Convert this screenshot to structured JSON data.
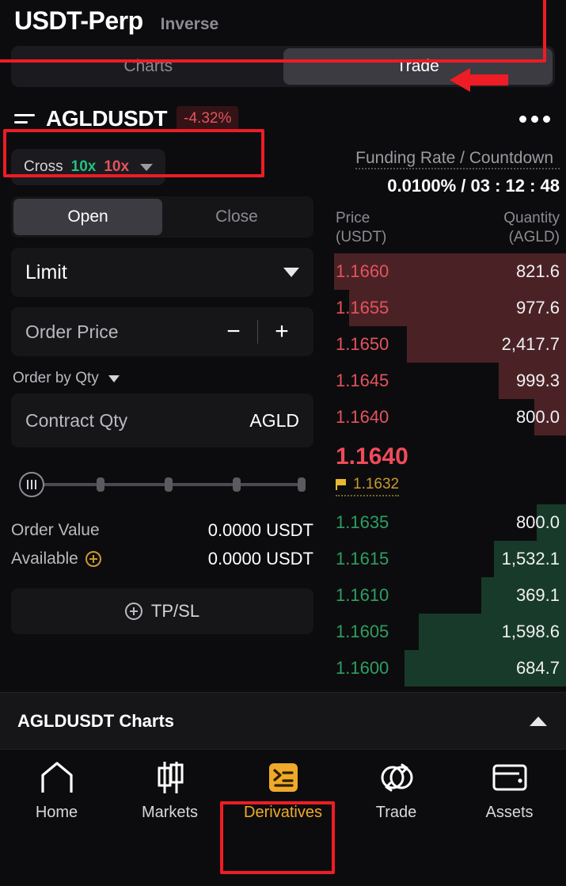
{
  "header": {
    "title": "USDT-Perp",
    "subtitle": "Inverse"
  },
  "tabs": {
    "items": [
      {
        "label": "Charts",
        "active": false
      },
      {
        "label": "Trade",
        "active": true
      }
    ]
  },
  "symbol": {
    "icon": "list-icon",
    "name": "AGLDUSDT",
    "change": "-4.32%",
    "change_color": "#e4535e",
    "more": "more-options-icon"
  },
  "order_form": {
    "margin_mode": "Cross",
    "leverage_long": "10x",
    "leverage_short": "10x",
    "side_tabs": [
      {
        "label": "Open",
        "active": true
      },
      {
        "label": "Close",
        "active": false
      }
    ],
    "order_type": "Limit",
    "price_placeholder": "Order Price",
    "minus_label": "−",
    "plus_label": "+",
    "order_by": "Order by Qty",
    "qty_placeholder": "Contract Qty",
    "qty_unit": "AGLD",
    "slider_percent": 0,
    "order_value_label": "Order Value",
    "order_value": "0.0000 USDT",
    "available_label": "Available",
    "available_value": "0.0000 USDT",
    "tpsl_label": "TP/SL"
  },
  "orderbook": {
    "funding_label": "Funding Rate / Countdown",
    "funding_value": "0.0100% / 03 : 12 : 48",
    "col_price": "Price",
    "col_price_unit": "(USDT)",
    "col_qty": "Quantity",
    "col_qty_unit": "(AGLD)",
    "asks": [
      {
        "price": "1.1660",
        "qty": "821.6",
        "depth": 96
      },
      {
        "price": "1.1655",
        "qty": "977.6",
        "depth": 90
      },
      {
        "price": "1.1650",
        "qty": "2,417.7",
        "depth": 66
      },
      {
        "price": "1.1645",
        "qty": "999.3",
        "depth": 28
      },
      {
        "price": "1.1640",
        "qty": "800.0",
        "depth": 13
      }
    ],
    "bids": [
      {
        "price": "1.1635",
        "qty": "800.0",
        "depth": 12
      },
      {
        "price": "1.1615",
        "qty": "1,532.1",
        "depth": 30
      },
      {
        "price": "1.1610",
        "qty": "369.1",
        "depth": 35
      },
      {
        "price": "1.1605",
        "qty": "1,598.6",
        "depth": 61
      },
      {
        "price": "1.1600",
        "qty": "684.7",
        "depth": 67
      }
    ],
    "last_price": "1.1640",
    "mark_price": "1.1632",
    "ask_color": "#e4535e",
    "bid_color": "#2e9e62",
    "ask_depth_color": "#4a2226",
    "bid_depth_color": "#183a2a",
    "mark_color": "#c99a2e"
  },
  "charts_bar": {
    "label": "AGLDUSDT Charts",
    "chevron": "chevron-up-icon"
  },
  "bottom_nav": {
    "items": [
      {
        "label": "Home",
        "icon": "home-icon",
        "active": false
      },
      {
        "label": "Markets",
        "icon": "candlestick-icon",
        "active": false
      },
      {
        "label": "Derivatives",
        "icon": "derivatives-icon",
        "active": true
      },
      {
        "label": "Trade",
        "icon": "swap-icon",
        "active": false
      },
      {
        "label": "Assets",
        "icon": "wallet-icon",
        "active": false
      }
    ],
    "active_color": "#f0a92a"
  },
  "annotations": {
    "highlight_color": "#ee1c25",
    "boxes": [
      "tabs-highlight",
      "symbol-highlight",
      "derivatives-highlight"
    ],
    "arrow": "left-pointing-arrow"
  }
}
